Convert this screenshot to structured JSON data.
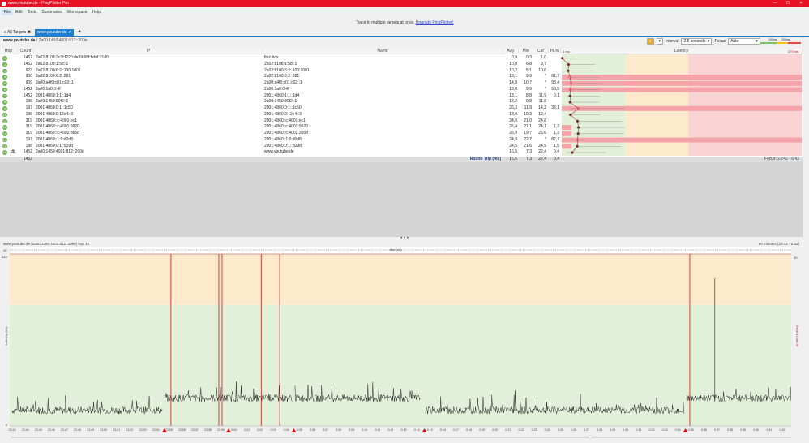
{
  "window": {
    "title": "www.youtube.de - PingPlotter Pro",
    "controls": [
      "—",
      "☐",
      "✕"
    ]
  },
  "menu": [
    "File",
    "Edit",
    "Tools",
    "Summaries",
    "Workspace",
    "Help"
  ],
  "banner": {
    "text": "Trace to multiple targets at once. ",
    "link": "Upgrade PingPlotter!"
  },
  "tabs": [
    {
      "label": "All Targets",
      "icon": "list-icon",
      "close": "✖"
    },
    {
      "label": "www.youtube.de",
      "icon": "check-icon",
      "close": "✔"
    }
  ],
  "add_tab": "+",
  "breadcrumb": {
    "target": "www.youtube.de",
    "sep": " / ",
    "ip": "2a00:1450:4001:812::200e"
  },
  "toolbar": {
    "pause": "⏸",
    "dropdown": "▾",
    "interval_label": "Interval",
    "interval_value": "2.5 seconds",
    "focus_label": "Focus",
    "focus_value": "Auto",
    "legend_100": "100ms",
    "legend_200": "200ms"
  },
  "table": {
    "headers": {
      "hop": "Hop",
      "count": "Count",
      "ip": "IP",
      "name": "Name",
      "avg": "Avg",
      "min": "Min",
      "cur": "Cur",
      "pl": "PL%",
      "latency": "Latency",
      "scale_min": "0 ms",
      "scale_max": "379 ms"
    },
    "rows": [
      {
        "hop": "1",
        "count": "1452",
        "ip": "2a02:8108:2c3f:f220:de39:6fff:febd:31d0",
        "name": "fritz.box",
        "avg": "0,9",
        "min": "0,3",
        "cur": "1,0",
        "pl": ""
      },
      {
        "hop": "2",
        "count": "1452",
        "ip": "2a02:8108:1:58::1",
        "name": "2a02:8108:1:58::1",
        "avg": "10,8",
        "min": "6,8",
        "cur": "9,7",
        "pl": ""
      },
      {
        "hop": "3",
        "count": "923",
        "ip": "2a02:8100:6:2::100:1001",
        "name": "2a02:8100:6:2::100:1001",
        "avg": "10,2",
        "min": "5,1",
        "cur": "10,6",
        "pl": ""
      },
      {
        "hop": "4",
        "count": "900",
        "ip": "2a02:8100:6:2::281",
        "name": "2a02:8100:6:2::281",
        "avg": "13,1",
        "min": "9,9",
        "cur": "*",
        "pl": "81,7"
      },
      {
        "hop": "5",
        "count": "909",
        "ip": "2a00:a4f0:c01:c02::1",
        "name": "2a00:a4f0:c01:c02::1",
        "avg": "14,8",
        "min": "10,7",
        "cur": "*",
        "pl": "93,4"
      },
      {
        "hop": "6",
        "count": "1452",
        "ip": "2a00:1a0:0:4f",
        "name": "2a00:1a0:0:4f",
        "avg": "13,8",
        "min": "9,9",
        "cur": "*",
        "pl": "93,5"
      },
      {
        "hop": "7",
        "count": "1452",
        "ip": "2001:4860:1:1::1d4",
        "name": "2001:4860:1:1::1d4",
        "avg": "13,1",
        "min": "8,8",
        "cur": "11,9",
        "pl": "0,1"
      },
      {
        "hop": "8",
        "count": "198",
        "ip": "2a00:1450:80f2::1",
        "name": "2a00:1450:80f2::1",
        "avg": "13,2",
        "min": "9,8",
        "cur": "11,8",
        "pl": ""
      },
      {
        "hop": "9",
        "count": "197",
        "ip": "2001:4860:0:1::1c50",
        "name": "2001:4860:0:1::1c50",
        "avg": "26,3",
        "min": "11,9",
        "cur": "14,2",
        "pl": "38,1"
      },
      {
        "hop": "10",
        "count": "198",
        "ip": "2001:4860:0:12e4::3",
        "name": "2001:4860:0:12e4::3",
        "avg": "13,9",
        "min": "10,3",
        "cur": "12,4",
        "pl": ""
      },
      {
        "hop": "11",
        "count": "319",
        "ip": "2001:4860::c:4001:ec1",
        "name": "2001:4860::c:4001:ec1",
        "avg": "24,9",
        "min": "21,0",
        "cur": "24,8",
        "pl": ""
      },
      {
        "hop": "12",
        "count": "319",
        "ip": "2001:4860::c:4001:9920",
        "name": "2001:4860::c:4001:9920",
        "avg": "26,4",
        "min": "21,1",
        "cur": "24,1",
        "pl": "1,3"
      },
      {
        "hop": "13",
        "count": "319",
        "ip": "2001:4860::c:4002:365d",
        "name": "2001:4860::c:4002:365d",
        "avg": "25,9",
        "min": "19,7",
        "cur": "25,6",
        "pl": "1,3"
      },
      {
        "hop": "14",
        "count": "197",
        "ip": "2001:4860::1:0:d0d8",
        "name": "2001:4860::1:0:d0d8",
        "avg": "24,9",
        "min": "22,7",
        "cur": "*",
        "pl": "82,7"
      },
      {
        "hop": "15",
        "count": "198",
        "ip": "2001:4860:0:1::509d",
        "name": "2001:4860:0:1::509d",
        "avg": "24,5",
        "min": "21,6",
        "cur": "24,9",
        "pl": "1,5"
      },
      {
        "hop": "16",
        "count": "1452",
        "ip": "2a00:1450:4001:812::200e",
        "name": "www.youtube.de",
        "avg": "16,5",
        "min": "7,3",
        "cur": "22,4",
        "pl": "0,4",
        "badge": "db"
      }
    ],
    "summary": {
      "count": "1452",
      "label": "Round Trip (ms)",
      "avg": "16,5",
      "min": "7,3",
      "cur": "22,4",
      "pl": "0,4"
    },
    "focus": "Focus: 23:42 - 0:42"
  },
  "graph": {
    "title": "www.youtube.de (2a00:1450:4001:812::200e) hop 16",
    "range": "60 minutes (23:42 - 0:42)",
    "jitter_label": "Jitter (ms)",
    "colors": {
      "good": "#e2f0d9",
      "warn": "#fde9cc",
      "bad": "#f9d3d3",
      "line": "#222222",
      "loss": "#d01818"
    }
  },
  "chart_data": {
    "type": "line",
    "ylabel": "Latency (ms)",
    "y2label": "Packet Loss %",
    "ylim": [
      0,
      140
    ],
    "y_ticks": [
      "140",
      "0"
    ],
    "jitter_tick": "35",
    "y2_tick": "30",
    "x_ticks": [
      "23:43",
      "23:44",
      "23:45",
      "23:46",
      "23:47",
      "23:48",
      "23:49",
      "23:50",
      "23:51",
      "23:52",
      "23:53",
      "23:54",
      "23:55",
      "23:56",
      "23:57",
      "23:58",
      "23:59",
      "0:00",
      "0:01",
      "0:02",
      "0:03",
      "0:04",
      "0:05",
      "0:06",
      "0:07",
      "0:08",
      "0:09",
      "0:10",
      "0:11",
      "0:12",
      "0:13",
      "0:14",
      "0:15",
      "0:16",
      "0:17",
      "0:18",
      "0:19",
      "0:20",
      "0:21",
      "0:22",
      "0:23",
      "0:24",
      "0:25",
      "0:26",
      "0:27",
      "0:28",
      "0:29",
      "0:30",
      "0:31",
      "0:32",
      "0:33",
      "0:34",
      "0:35",
      "0:36",
      "0:37",
      "0:38",
      "0:39",
      "0:40",
      "0:41",
      "0:42"
    ],
    "segments": [
      {
        "from": "23:43:00",
        "to": "23:54:30",
        "latency_ms": 13
      },
      {
        "from": "23:54:40",
        "to": "0:04:30",
        "latency_ms": 23
      },
      {
        "from": "0:04:40",
        "to": "0:14:20",
        "latency_ms": 23
      },
      {
        "from": "0:14:40",
        "to": "0:34:30",
        "latency_ms": 13
      },
      {
        "from": "0:34:40",
        "to": "0:42:40",
        "latency_ms": 23
      }
    ],
    "spikes": [
      {
        "time": "0:36:50",
        "latency_ms": 122
      }
    ],
    "loss_events": [
      "23:55:10",
      "23:58:50",
      "23:59:05",
      "0:02:05",
      "0:03:30",
      "0:34:55"
    ],
    "route_changes": [
      "23:54:40",
      "23:59:35",
      "0:04:35",
      "0:14:35",
      "0:34:35"
    ]
  }
}
